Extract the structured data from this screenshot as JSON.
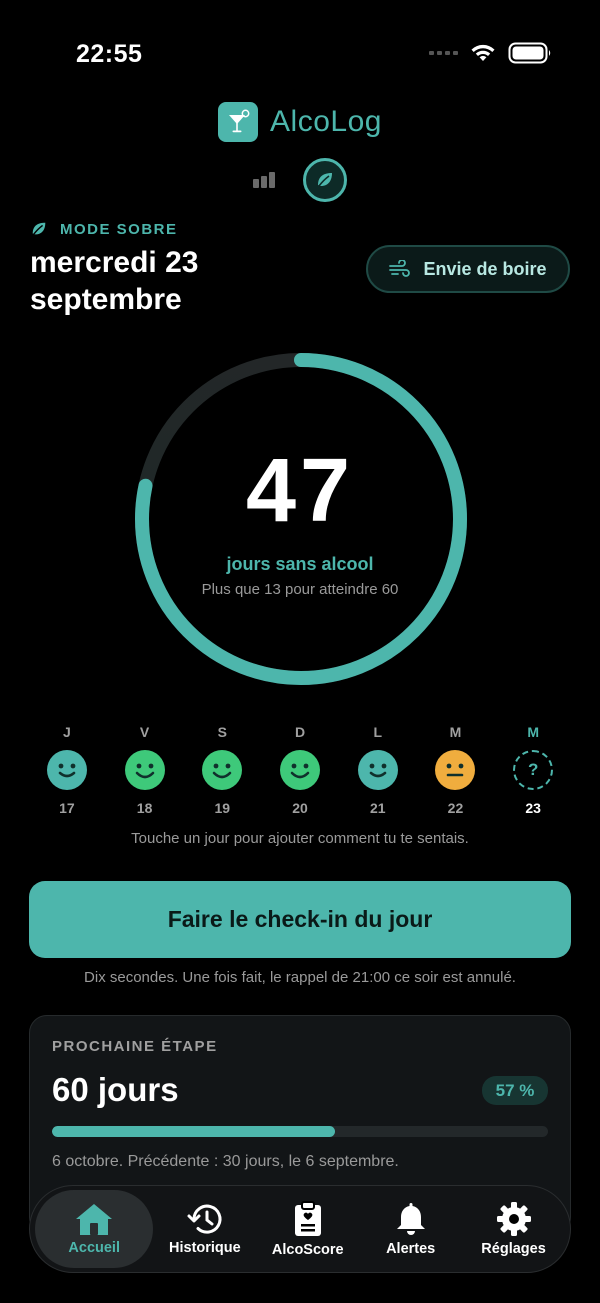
{
  "status_bar": {
    "time": "22:55",
    "signal_icon": "signal-icon",
    "wifi_icon": "wifi-icon",
    "battery_icon": "battery-icon"
  },
  "header": {
    "app_name": "AlcoLog",
    "logo_icon": "cocktail-glass-icon",
    "mode_options": [
      {
        "icon": "bar-chart-icon",
        "active": false
      },
      {
        "icon": "leaf-icon",
        "active": true
      }
    ]
  },
  "mode": {
    "label": "MODE SOBRE",
    "icon": "leaf-icon"
  },
  "date": "mercredi 23 septembre",
  "craving_button": {
    "label": "Envie de boire",
    "icon": "wind-icon"
  },
  "counter": {
    "days": "47",
    "label": "jours sans alcool",
    "subtitle": "Plus que 13 pour atteindre 60",
    "progress": 0.7833
  },
  "week": {
    "days": [
      {
        "letter": "J",
        "number": "17",
        "mood": "content"
      },
      {
        "letter": "V",
        "number": "18",
        "mood": "happy"
      },
      {
        "letter": "S",
        "number": "19",
        "mood": "happy"
      },
      {
        "letter": "D",
        "number": "20",
        "mood": "happy"
      },
      {
        "letter": "L",
        "number": "21",
        "mood": "content"
      },
      {
        "letter": "M",
        "number": "22",
        "mood": "neutral"
      },
      {
        "letter": "M",
        "number": "23",
        "mood": "unknown",
        "symbol": "?"
      }
    ],
    "hint": "Touche un jour pour ajouter comment tu te sentais."
  },
  "colors": {
    "accent": "#4db6ac",
    "happy": "#3ec97a",
    "content": "#4db6ac",
    "neutral": "#f0ad3e",
    "background": "#000000"
  },
  "checkin": {
    "label": "Faire le check-in du jour",
    "hint": "Dix secondes. Une fois fait, le rappel de 21:00 ce soir est annulé."
  },
  "milestone": {
    "label": "PROCHAINE ÉTAPE",
    "title": "60 jours",
    "percent": "57 %",
    "progress": 0.57,
    "subtitle": "6 octobre. Précédente : 30 jours, le 6 septembre."
  },
  "tabs": [
    {
      "label": "Accueil",
      "icon": "home-icon",
      "active": true
    },
    {
      "label": "Historique",
      "icon": "history-icon",
      "active": false
    },
    {
      "label": "AlcoScore",
      "icon": "clipboard-heart-icon",
      "active": false
    },
    {
      "label": "Alertes",
      "icon": "bell-icon",
      "active": false
    },
    {
      "label": "Réglages",
      "icon": "gear-icon",
      "active": false
    }
  ]
}
